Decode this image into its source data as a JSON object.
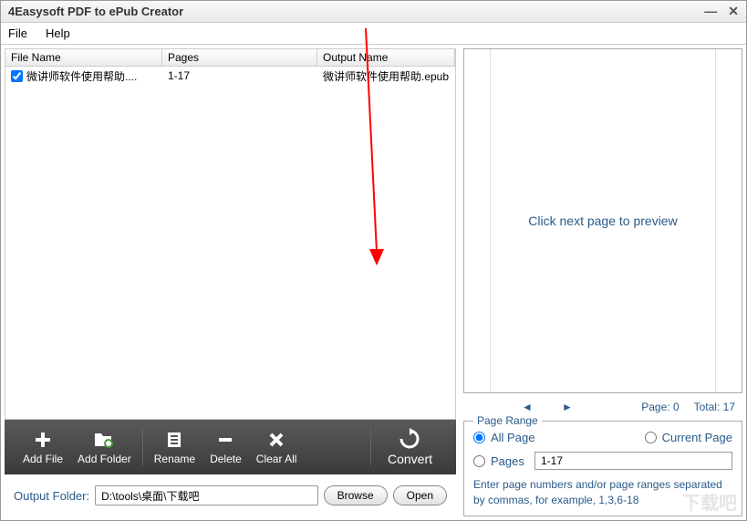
{
  "window": {
    "title": "4Easysoft PDF to ePub Creator"
  },
  "menu": {
    "file": "File",
    "help": "Help"
  },
  "table": {
    "headers": {
      "name": "File Name",
      "pages": "Pages",
      "output": "Output Name"
    },
    "rows": [
      {
        "name": "微讲师软件使用帮助....",
        "pages": "1-17",
        "output": "微讲师软件使用帮助.epub",
        "checked": true
      }
    ]
  },
  "toolbar": {
    "addFile": "Add File",
    "addFolder": "Add Folder",
    "rename": "Rename",
    "delete": "Delete",
    "clearAll": "Clear All",
    "convert": "Convert"
  },
  "output": {
    "label": "Output Folder:",
    "path": "D:\\tools\\桌面\\下载吧",
    "browse": "Browse",
    "open": "Open"
  },
  "preview": {
    "message": "Click next page to preview",
    "pageLabel": "Page: 0",
    "totalLabel": "Total: 17"
  },
  "pageRange": {
    "legend": "Page Range",
    "allPage": "All Page",
    "currentPage": "Current Page",
    "pages": "Pages",
    "rangeValue": "1-17",
    "hint": "Enter page numbers and/or page ranges separated by commas, for example, 1,3,6-18",
    "selected": "all"
  },
  "watermark": "下载吧"
}
